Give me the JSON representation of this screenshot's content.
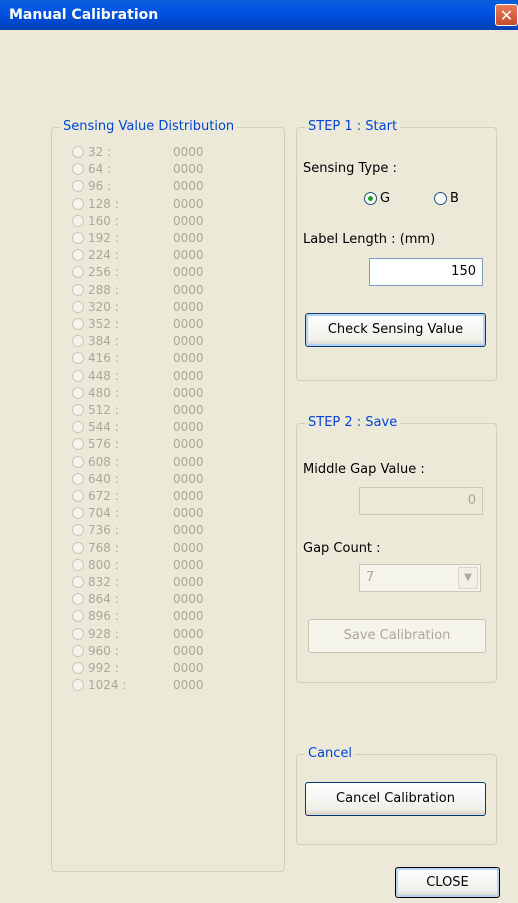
{
  "window": {
    "title": "Manual Calibration",
    "close_glyph": "✕"
  },
  "distribution": {
    "title": "Sensing Value Distribution",
    "rows": [
      {
        "label": "32 :",
        "value": "0000"
      },
      {
        "label": "64 :",
        "value": "0000"
      },
      {
        "label": "96 :",
        "value": "0000"
      },
      {
        "label": "128 :",
        "value": "0000"
      },
      {
        "label": "160 :",
        "value": "0000"
      },
      {
        "label": "192 :",
        "value": "0000"
      },
      {
        "label": "224 :",
        "value": "0000"
      },
      {
        "label": "256 :",
        "value": "0000"
      },
      {
        "label": "288 :",
        "value": "0000"
      },
      {
        "label": "320 :",
        "value": "0000"
      },
      {
        "label": "352 :",
        "value": "0000"
      },
      {
        "label": "384 :",
        "value": "0000"
      },
      {
        "label": "416 :",
        "value": "0000"
      },
      {
        "label": "448 :",
        "value": "0000"
      },
      {
        "label": "480 :",
        "value": "0000"
      },
      {
        "label": "512 :",
        "value": "0000"
      },
      {
        "label": "544 :",
        "value": "0000"
      },
      {
        "label": "576 :",
        "value": "0000"
      },
      {
        "label": "608 :",
        "value": "0000"
      },
      {
        "label": "640 :",
        "value": "0000"
      },
      {
        "label": "672 :",
        "value": "0000"
      },
      {
        "label": "704 :",
        "value": "0000"
      },
      {
        "label": "736 :",
        "value": "0000"
      },
      {
        "label": "768 :",
        "value": "0000"
      },
      {
        "label": "800 :",
        "value": "0000"
      },
      {
        "label": "832 :",
        "value": "0000"
      },
      {
        "label": "864 :",
        "value": "0000"
      },
      {
        "label": "896 :",
        "value": "0000"
      },
      {
        "label": "928 :",
        "value": "0000"
      },
      {
        "label": "960 :",
        "value": "0000"
      },
      {
        "label": "992 :",
        "value": "0000"
      },
      {
        "label": "1024 :",
        "value": "0000"
      }
    ]
  },
  "step1": {
    "title": "STEP 1 : Start",
    "sensing_type_label": "Sensing Type :",
    "option_g": "G",
    "option_b": "B",
    "selected": "G",
    "label_length_label": "Label Length : (mm)",
    "label_length_value": "150",
    "check_button": "Check Sensing Value"
  },
  "step2": {
    "title": "STEP 2 : Save",
    "middle_gap_label": "Middle Gap Value :",
    "middle_gap_value": "0",
    "gap_count_label": "Gap Count :",
    "gap_count_value": "7",
    "save_button": "Save Calibration"
  },
  "cancel": {
    "title": "Cancel",
    "button": "Cancel Calibration"
  },
  "close_button": "CLOSE"
}
